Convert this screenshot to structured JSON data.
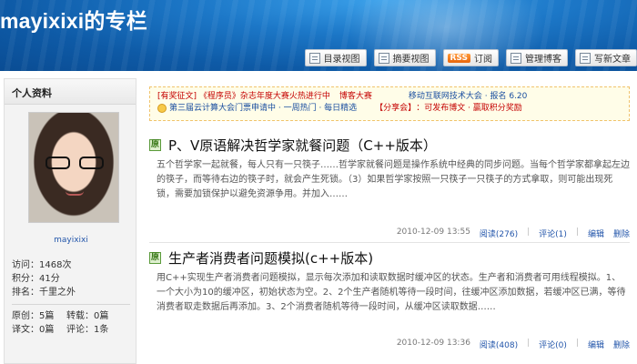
{
  "header": {
    "title": "mayixixi的专栏"
  },
  "toolbar": {
    "buttons": [
      {
        "label": "目录视图",
        "icon": "list-icon"
      },
      {
        "label": "摘要视图",
        "icon": "summary-icon"
      },
      {
        "label": "订阅",
        "icon": "rss-icon",
        "rss_label": "RSS"
      },
      {
        "label": "管理博客",
        "icon": "manage-icon"
      },
      {
        "label": "写新文章",
        "icon": "write-icon"
      }
    ]
  },
  "sidebar": {
    "panel_title": "个人资料",
    "username": "mayixixi",
    "stats": {
      "visits": "访问：1468次",
      "points": "积分：41分",
      "rank": "排名：千里之外",
      "original": "原创：5篇",
      "reprint": "转载：0篇",
      "translated": "译文：0篇",
      "comments": "评论：1条"
    }
  },
  "notice": {
    "line1_a": "[有奖征文] 《程序员》杂志年度大赛火热进行中",
    "line1_b": "博客大赛",
    "line1_c": "移动互联网技术大会 · 报名 6.20",
    "line2_a": "第三届云计算大会门票申请中 · 一周热门 · 每日精选",
    "line2_b": "【分享会】",
    "line2_c": "：可发布博文 · 赢取积分奖励"
  },
  "articles": [
    {
      "badge": "原",
      "title": "P、V原语解决哲学家就餐问题（C++版本）",
      "summary": "五个哲学家一起就餐，每人只有一只筷子……哲学家就餐问题是操作系统中经典的同步问题。当每个哲学家都拿起左边的筷子，而等待右边的筷子时，就会产生死锁。（3）如果哲学家按照一只筷子一只筷子的方式拿取，则可能出现死锁，需要加锁保护以避免资源争用。并加入……",
      "date": "2010-12-09 13:55",
      "read": "阅读(276)",
      "comment": "评论(1)",
      "edit": "编辑",
      "delete": "删除"
    },
    {
      "badge": "原",
      "title": "生产者消费者问题模拟(c++版本)",
      "summary": "用C++实现生产者消费者问题模拟，显示每次添加和读取数据时缓冲区的状态。生产者和消费者可用线程模拟。1、一个大小为10的缓冲区，初始状态为空。2、2个生产者随机等待一段时间，往缓冲区添加数据，若缓冲区已满，等待消费者取走数据后再添加。3、2个消费者随机等待一段时间，从缓冲区读取数据……",
      "date": "2010-12-09 13:36",
      "read": "阅读(408)",
      "comment": "评论(0)",
      "edit": "编辑",
      "delete": "删除"
    }
  ]
}
